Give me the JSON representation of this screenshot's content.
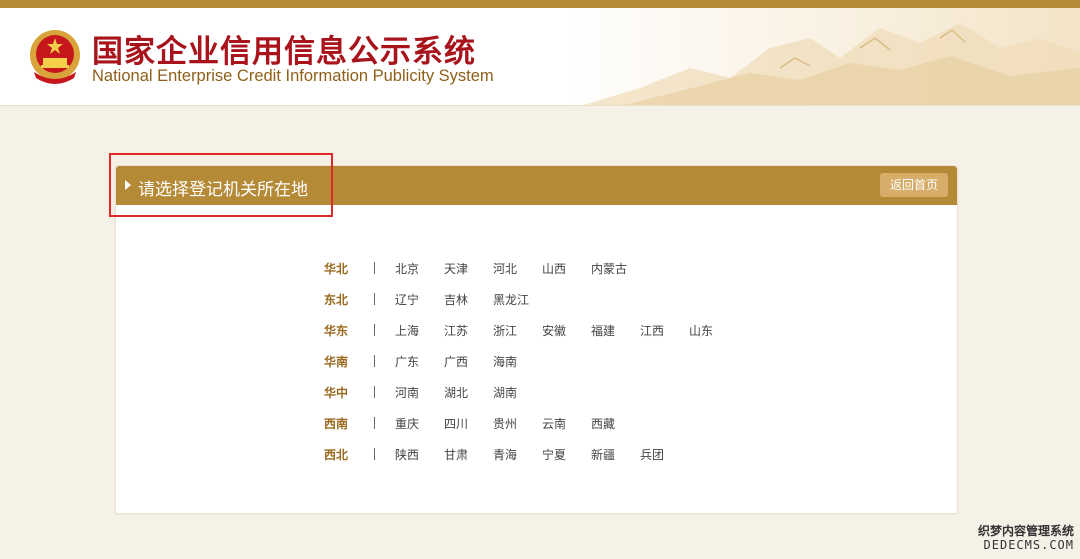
{
  "colors": {
    "brand_gold": "#b58a37",
    "title_red": "#a8131c",
    "highlight_red": "#e0272a",
    "button_tan": "#d6ae6a"
  },
  "header": {
    "logo_icon": "national-emblem",
    "title": "国家企业信用信息公示系统",
    "subtitle": "National Enterprise Credit Information Publicity System"
  },
  "panel": {
    "title": "请选择登记机关所在地",
    "home_button": "返回首页"
  },
  "regions": [
    {
      "name": "华北",
      "provinces": [
        "北京",
        "天津",
        "河北",
        "山西",
        "内蒙古"
      ]
    },
    {
      "name": "东北",
      "provinces": [
        "辽宁",
        "吉林",
        "黑龙江"
      ]
    },
    {
      "name": "华东",
      "provinces": [
        "上海",
        "江苏",
        "浙江",
        "安徽",
        "福建",
        "江西",
        "山东"
      ]
    },
    {
      "name": "华南",
      "provinces": [
        "广东",
        "广西",
        "海南"
      ]
    },
    {
      "name": "华中",
      "provinces": [
        "河南",
        "湖北",
        "湖南"
      ]
    },
    {
      "name": "西南",
      "provinces": [
        "重庆",
        "四川",
        "贵州",
        "云南",
        "西藏"
      ]
    },
    {
      "name": "西北",
      "provinces": [
        "陕西",
        "甘肃",
        "青海",
        "宁夏",
        "新疆",
        "兵团"
      ]
    }
  ],
  "watermark": {
    "line1": "织梦内容管理系统",
    "line2": "DEDECMS.COM"
  }
}
